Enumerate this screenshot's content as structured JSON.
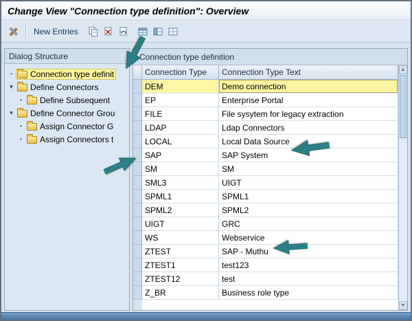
{
  "window": {
    "title": "Change View \"Connection type definition\": Overview"
  },
  "toolbar": {
    "new_entries_label": "New Entries",
    "icons": [
      "utilities",
      "copy-as",
      "delete",
      "undo-change",
      "select-all",
      "select-block",
      "deselect-all"
    ]
  },
  "dialog_structure": {
    "header": "Dialog Structure",
    "items": [
      {
        "bullet": "•",
        "label": "Connection type definit",
        "level": 0,
        "selected": true
      },
      {
        "bullet": "▼",
        "label": "Define Connectors",
        "level": 0,
        "selected": false
      },
      {
        "bullet": "•",
        "label": "Define Subsequent",
        "level": 1,
        "selected": false
      },
      {
        "bullet": "▼",
        "label": "Define Connector Grou",
        "level": 0,
        "selected": false
      },
      {
        "bullet": "•",
        "label": "Assign Connector G",
        "level": 1,
        "selected": false
      },
      {
        "bullet": "•",
        "label": "Assign Connectors t",
        "level": 1,
        "selected": false
      }
    ]
  },
  "table": {
    "section_title": "Connection type definition",
    "columns": [
      "Connection Type",
      "Connection Type Text"
    ],
    "rows": [
      {
        "type": "DEM",
        "text": "Demo connection",
        "selected": true
      },
      {
        "type": "EP",
        "text": "Enterprise Portal",
        "selected": false
      },
      {
        "type": "FILE",
        "text": "File sysytem for legacy extraction",
        "selected": false
      },
      {
        "type": "LDAP",
        "text": "Ldap Connectors",
        "selected": false
      },
      {
        "type": "LOCAL",
        "text": "Local Data Source",
        "selected": false
      },
      {
        "type": "SAP",
        "text": "SAP System",
        "selected": false
      },
      {
        "type": "SM",
        "text": "SM",
        "selected": false
      },
      {
        "type": "SML3",
        "text": "UIGT",
        "selected": false
      },
      {
        "type": "SPML1",
        "text": "SPML1",
        "selected": false
      },
      {
        "type": "SPML2",
        "text": "SPML2",
        "selected": false
      },
      {
        "type": "UIGT",
        "text": "GRC",
        "selected": false
      },
      {
        "type": "WS",
        "text": "Webservice",
        "selected": false
      },
      {
        "type": "ZTEST",
        "text": "SAP - Muthu",
        "selected": false
      },
      {
        "type": "ZTEST1",
        "text": "test123",
        "selected": false
      },
      {
        "type": "ZTEST12",
        "text": "test",
        "selected": false
      },
      {
        "type": "Z_BR",
        "text": "Business role type",
        "selected": false
      }
    ]
  },
  "annotations": {
    "arrow_color": "#2a8186",
    "arrows": [
      "points-to-dialog-structure-selection",
      "points-to-local-row",
      "points-to-sap-row",
      "points-to-ws-row"
    ]
  },
  "colors": {
    "selection_yellow": "#fdf5a3",
    "panel_blue": "#d9e4ef",
    "bottom_strip_blue": "#46739f"
  }
}
